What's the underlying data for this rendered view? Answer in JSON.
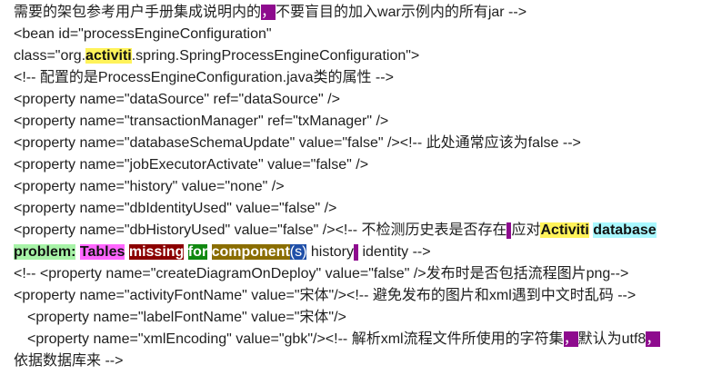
{
  "lines": {
    "l1a": "需要的架包参考用户手册集成说明内的",
    "l1p": "，",
    "l1b": "不要盲目的加入war示例内的所有jar -->",
    "l2": "<bean id=\"processEngineConfiguration\"",
    "l3a": "class=\"org.",
    "l3h": "activiti",
    "l3b": ".spring.SpringProcessEngineConfiguration\">",
    "l4": "<!-- 配置的是ProcessEngineConfiguration.java类的属性 -->",
    "l5": "<property name=\"dataSource\" ref=\"dataSource\" />",
    "l6": "<property name=\"transactionManager\" ref=\"txManager\" />",
    "l7": "<property name=\"databaseSchemaUpdate\" value=\"false\" /><!-- 此处通常应该为false -->",
    "l8": "<property name=\"jobExecutorActivate\" value=\"false\" />",
    "l9": "<property name=\"history\" value=\"none\" />",
    "l10": "<property name=\"dbIdentityUsed\" value=\"false\" />",
    "l11a": "<property name=\"dbHistoryUsed\" value=\"false\" /><!-- 不检测历史表是否存在",
    "l11b": "应对",
    "l11h1": "Activiti",
    "l11h2": "database",
    "l12h1": "problem:",
    "l12h2": "Tables",
    "l12h3": "missing",
    "l12h4": "for",
    "l12h5": "component",
    "l12h6": "(s)",
    "l12a": " history",
    "l12b": " identity -->",
    "l13": "<!-- <property name=\"createDiagramOnDeploy\" value=\"false\" />发布时是否包括流程图片png-->",
    "l14": "<property name=\"activityFontName\" value=\"宋体\"/><!-- 避免发布的图片和xml遇到中文时乱码 -->",
    "l15": "<property name=\"labelFontName\" value=\"宋体\"/>",
    "l16a": "<property name=\"xmlEncoding\" value=\"gbk\"/><!-- 解析xml流程文件所使用的字符集",
    "l16p1": "，",
    "l16b": "默认为utf8",
    "l16p2": "，",
    "l17": "依据数据库来 -->"
  }
}
